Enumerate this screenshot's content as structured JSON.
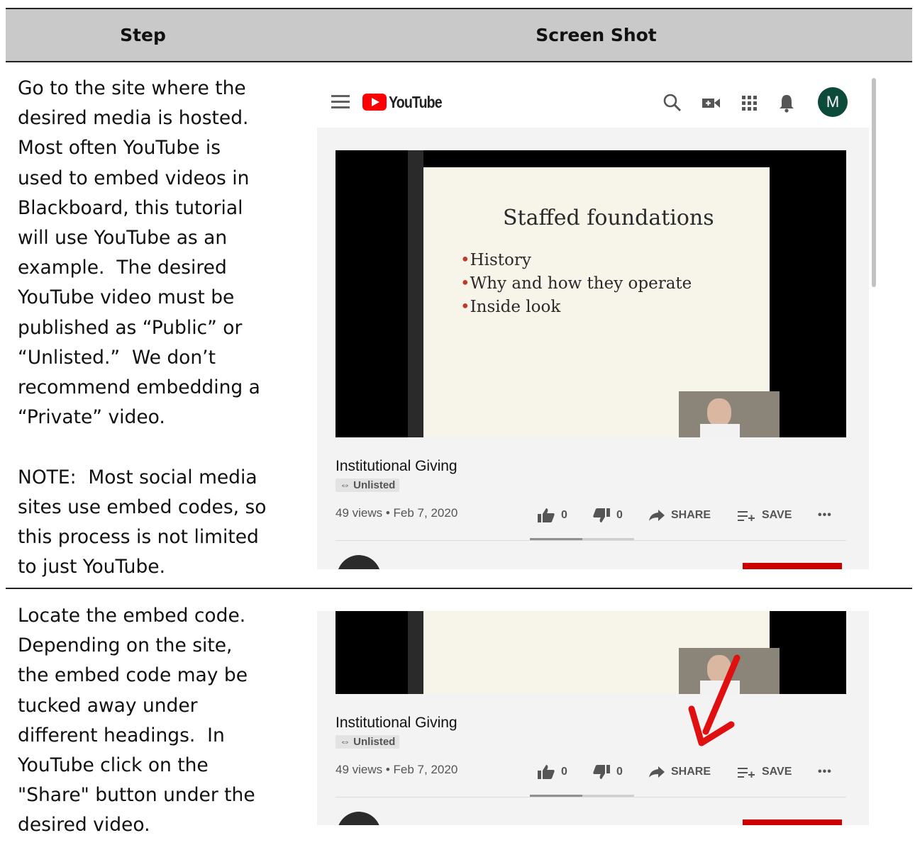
{
  "table": {
    "header_step": "Step",
    "header_shot": "Screen Shot"
  },
  "rows": [
    {
      "text": "Go to the site where the desired media is hosted. Most often YouTube is used to embed videos in Blackboard, this tutorial will use YouTube as an example.  The desired YouTube video must be published as “Public” or “Unlisted.”  We don’t recommend embedding a “Private” video.\n\nNOTE:  Most social media sites use embed codes, so this process is not limited to just YouTube."
    },
    {
      "text": "Locate the embed code. Depending on the site, the embed code may be tucked away under different headings.  In YouTube click on the \"Share\" button under the desired video."
    }
  ],
  "youtube": {
    "logo_text": "YouTube",
    "avatar_letter": "M",
    "slide_title": "Staffed foundations",
    "slide_bullets": [
      "History",
      "Why and how they operate",
      "Inside look"
    ],
    "video_title": "Institutional Giving",
    "visibility": "Unlisted",
    "views": "49 views • Feb 7, 2020",
    "likes": "0",
    "dislikes": "0",
    "share_label": "SHARE",
    "save_label": "SAVE",
    "more_label": "•••"
  },
  "colors": {
    "youtube_red": "#ff0000",
    "subscribe_red": "#cc0000",
    "arrow_red": "#e01010",
    "avatar_green": "#0c4a3a",
    "header_gray": "#c9c9c9"
  }
}
